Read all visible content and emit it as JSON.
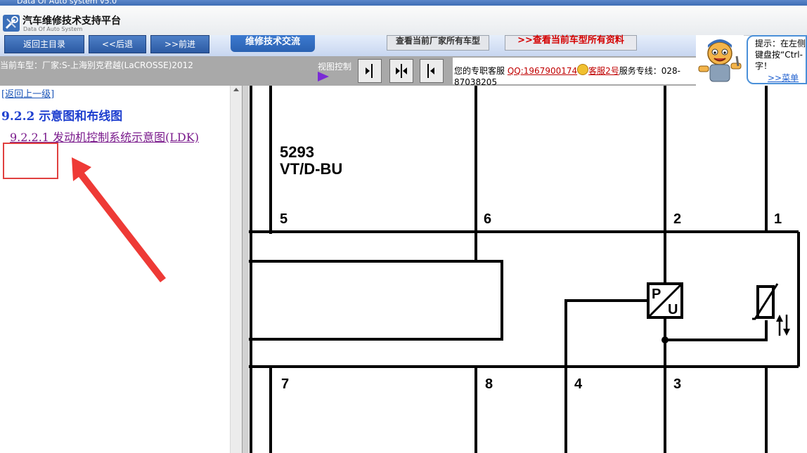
{
  "window": {
    "title": "Data Of Auto system v5.0"
  },
  "app": {
    "title": "汽车维修技术支持平台",
    "subtitle": "Data Of Auto System"
  },
  "nav": {
    "home": "返回主目录",
    "back": "<<后退",
    "forward": ">>前进",
    "forum": "维修技术交流",
    "view_all_models": "查看当前厂家所有车型",
    "view_all_data": ">>查看当前车型所有资料"
  },
  "info": {
    "car_model": "当前车型：厂家:S-上海别克君越(LaCROSSE)2012",
    "view_control": "视图控制",
    "service_prefix": "您的专职客服",
    "qq": "QQ:1967900174",
    "kefu": "客服2号",
    "hotline_label": "服务专线：028-",
    "hotline_rest": "87038205"
  },
  "tip": {
    "line1": "提示：在左侧",
    "line2": "键盘按“Ctrl-",
    "line3": "字！",
    "menu_link": ">>菜单关"
  },
  "left": {
    "back_link": "[返回上一级]",
    "section_title": "9.2.2 示意图和布线图",
    "sub_link": "9.2.2.1 发动机控制系统示意图(LDK)"
  },
  "diagram": {
    "part_no": "5293",
    "connector": "VT/D-BU",
    "sensor_p": "P",
    "sensor_u": "U",
    "pins": [
      {
        "label": "5"
      },
      {
        "label": "6"
      },
      {
        "label": "2"
      },
      {
        "label": "1"
      },
      {
        "label": "7"
      },
      {
        "label": "8"
      },
      {
        "label": "4"
      },
      {
        "label": "3"
      }
    ]
  }
}
